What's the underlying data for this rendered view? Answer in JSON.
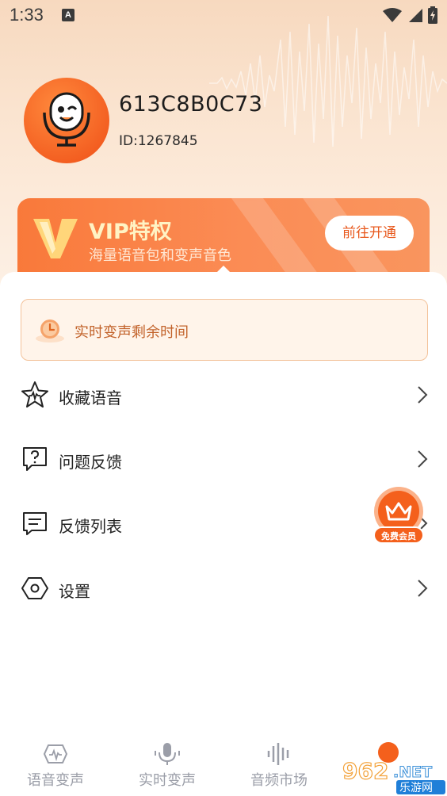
{
  "status_bar": {
    "time": "1:33",
    "notification_letter": "A"
  },
  "profile": {
    "username": "613C8B0C73",
    "user_id": "ID:1267845"
  },
  "vip_banner": {
    "title": "VIP特权",
    "subtitle": "海量语音包和变声音色",
    "button": "前往开通"
  },
  "timer": {
    "label": "实时变声剩余时间"
  },
  "menu": [
    {
      "label": "收藏语音",
      "icon": "star-wave-icon"
    },
    {
      "label": "问题反馈",
      "icon": "question-chat-icon"
    },
    {
      "label": "反馈列表",
      "icon": "message-list-icon"
    },
    {
      "label": "设置",
      "icon": "hexagon-settings-icon"
    }
  ],
  "floating_badge": {
    "label": "免费会员"
  },
  "bottom_nav": [
    {
      "label": "语音变声",
      "icon": "voice-monitor-icon"
    },
    {
      "label": "实时变声",
      "icon": "microphone-icon"
    },
    {
      "label": "音频市场",
      "icon": "audio-bars-icon"
    }
  ],
  "watermark": {
    "text_top": "962",
    "text_net": ".NET",
    "text_bottom": "乐游网"
  },
  "colors": {
    "accent": "#f9793a",
    "accent_dark": "#e8581c",
    "nav_gray": "#9b9ea8"
  }
}
